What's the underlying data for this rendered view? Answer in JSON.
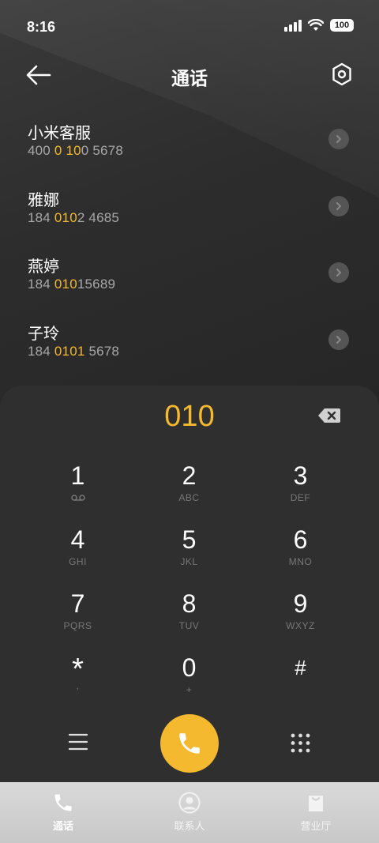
{
  "status_bar": {
    "time": "8:16",
    "battery": "100"
  },
  "header": {
    "title": "通话"
  },
  "contacts": [
    {
      "name": "小米客服",
      "number_parts": [
        "400 ",
        "0",
        " ",
        "10",
        "0 5678"
      ]
    },
    {
      "name": "雅娜",
      "number_parts": [
        "184 ",
        "010",
        "2 4685",
        "",
        ""
      ]
    },
    {
      "name": "燕婷",
      "number_parts": [
        "184 ",
        "010",
        "15689",
        "",
        ""
      ]
    },
    {
      "name": "子玲",
      "number_parts": [
        "184 ",
        "0101",
        " 5678",
        "",
        ""
      ]
    }
  ],
  "dialer": {
    "input": "010",
    "keys": [
      {
        "digit": "1",
        "letters": ""
      },
      {
        "digit": "2",
        "letters": "ABC"
      },
      {
        "digit": "3",
        "letters": "DEF"
      },
      {
        "digit": "4",
        "letters": "GHI"
      },
      {
        "digit": "5",
        "letters": "JKL"
      },
      {
        "digit": "6",
        "letters": "MNO"
      },
      {
        "digit": "7",
        "letters": "PQRS"
      },
      {
        "digit": "8",
        "letters": "TUV"
      },
      {
        "digit": "9",
        "letters": "WXYZ"
      },
      {
        "digit": "*",
        "letters": ","
      },
      {
        "digit": "0",
        "letters": "+"
      },
      {
        "digit": "#",
        "letters": ""
      }
    ]
  },
  "bottom_nav": {
    "calls": "通话",
    "contacts": "联系人",
    "store": "营业厅"
  },
  "colors": {
    "accent": "#f4b92f",
    "panel": "#2f2f2f"
  }
}
